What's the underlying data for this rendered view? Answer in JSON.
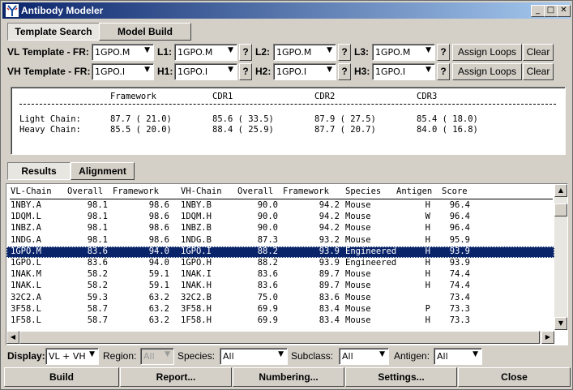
{
  "window": {
    "title": "Antibody Modeler",
    "minimize": "_",
    "maximize": "□",
    "close": "✕"
  },
  "top_tabs": [
    {
      "label": "Template Search"
    },
    {
      "label": "Model Build"
    }
  ],
  "vl_row": {
    "label": "VL Template - FR:",
    "fr": "1GPO.M",
    "l1_label": "L1:",
    "l1": "1GPO.M",
    "l2_label": "L2:",
    "l2": "1GPO.M",
    "l3_label": "L3:",
    "l3": "1GPO.M",
    "q": "?",
    "assign": "Assign Loops",
    "clear": "Clear"
  },
  "vh_row": {
    "label": "VH Template - FR:",
    "fr": "1GPO.I",
    "h1_label": "H1:",
    "h1": "1GPO.I",
    "h2_label": "H2:",
    "h2": "1GPO.I",
    "h3_label": "H3:",
    "h3": "1GPO.I",
    "q": "?",
    "assign": "Assign Loops",
    "clear": "Clear"
  },
  "summary": {
    "col_framework": "Framework",
    "col_cdr1": "CDR1",
    "col_cdr2": "CDR2",
    "col_cdr3": "CDR3",
    "rows": [
      {
        "label": "Light Chain:",
        "framework": "87.7 ( 21.0)",
        "cdr1": "85.6 ( 33.5)",
        "cdr2": "87.9 ( 27.5)",
        "cdr3": "85.4 ( 18.0)"
      },
      {
        "label": "Heavy Chain:",
        "framework": "85.5 ( 20.0)",
        "cdr1": "88.4 ( 25.9)",
        "cdr2": "87.7 ( 20.7)",
        "cdr3": "84.0 ( 16.8)"
      }
    ]
  },
  "result_tabs": [
    {
      "label": "Results"
    },
    {
      "label": "Alignment"
    }
  ],
  "table": {
    "headers": [
      "VL-Chain",
      "Overall",
      "Framework",
      "VH-Chain",
      "Overall",
      "Framework",
      "Species",
      "Antigen",
      "Score"
    ],
    "rows": [
      {
        "vl": "1NBY.A",
        "vl_overall": "98.1",
        "vl_fw": "98.6",
        "vh": "1NBY.B",
        "vh_overall": "90.0",
        "vh_fw": "94.2",
        "species": "Mouse",
        "antigen": "H",
        "score": "96.4"
      },
      {
        "vl": "1DQM.L",
        "vl_overall": "98.1",
        "vl_fw": "98.6",
        "vh": "1DQM.H",
        "vh_overall": "90.0",
        "vh_fw": "94.2",
        "species": "Mouse",
        "antigen": "W",
        "score": "96.4"
      },
      {
        "vl": "1NBZ.A",
        "vl_overall": "98.1",
        "vl_fw": "98.6",
        "vh": "1NBZ.B",
        "vh_overall": "90.0",
        "vh_fw": "94.2",
        "species": "Mouse",
        "antigen": "H",
        "score": "96.4"
      },
      {
        "vl": "1NDG.A",
        "vl_overall": "98.1",
        "vl_fw": "98.6",
        "vh": "1NDG.B",
        "vh_overall": "87.3",
        "vh_fw": "93.2",
        "species": "Mouse",
        "antigen": "H",
        "score": "95.9"
      },
      {
        "vl": "1GPO.M",
        "vl_overall": "83.6",
        "vl_fw": "94.0",
        "vh": "1GPO.I",
        "vh_overall": "88.2",
        "vh_fw": "93.9",
        "species": "Engineered",
        "antigen": "H",
        "score": "93.9",
        "selected": true
      },
      {
        "vl": "1GPO.L",
        "vl_overall": "83.6",
        "vl_fw": "94.0",
        "vh": "1GPO.H",
        "vh_overall": "88.2",
        "vh_fw": "93.9",
        "species": "Engineered",
        "antigen": "H",
        "score": "93.9"
      },
      {
        "vl": "1NAK.M",
        "vl_overall": "58.2",
        "vl_fw": "59.1",
        "vh": "1NAK.I",
        "vh_overall": "83.6",
        "vh_fw": "89.7",
        "species": "Mouse",
        "antigen": "H",
        "score": "74.4"
      },
      {
        "vl": "1NAK.L",
        "vl_overall": "58.2",
        "vl_fw": "59.1",
        "vh": "1NAK.H",
        "vh_overall": "83.6",
        "vh_fw": "89.7",
        "species": "Mouse",
        "antigen": "H",
        "score": "74.4"
      },
      {
        "vl": "32C2.A",
        "vl_overall": "59.3",
        "vl_fw": "63.2",
        "vh": "32C2.B",
        "vh_overall": "75.0",
        "vh_fw": "83.6",
        "species": "Mouse",
        "antigen": "",
        "score": "73.4"
      },
      {
        "vl": "3F58.L",
        "vl_overall": "58.7",
        "vl_fw": "63.2",
        "vh": "3F58.H",
        "vh_overall": "69.9",
        "vh_fw": "83.4",
        "species": "Mouse",
        "antigen": "P",
        "score": "73.3"
      },
      {
        "vl": "1F58.L",
        "vl_overall": "58.7",
        "vl_fw": "63.2",
        "vh": "1F58.H",
        "vh_overall": "69.9",
        "vh_fw": "83.4",
        "species": "Mouse",
        "antigen": "H",
        "score": "73.3"
      }
    ]
  },
  "filters": {
    "display_label": "Display:",
    "display": "VL + VH",
    "region_label": "Region:",
    "region": "All",
    "species_label": "Species:",
    "species": "All",
    "subclass_label": "Subclass:",
    "subclass": "All",
    "antigen_label": "Antigen:",
    "antigen": "All"
  },
  "actions": {
    "build": "Build",
    "report": "Report...",
    "numbering": "Numbering...",
    "settings": "Settings...",
    "close": "Close"
  },
  "colors": {
    "title_start": "#0a246a",
    "title_end": "#a6caf0",
    "selection": "#0a246a",
    "face": "#d4d0c8"
  }
}
